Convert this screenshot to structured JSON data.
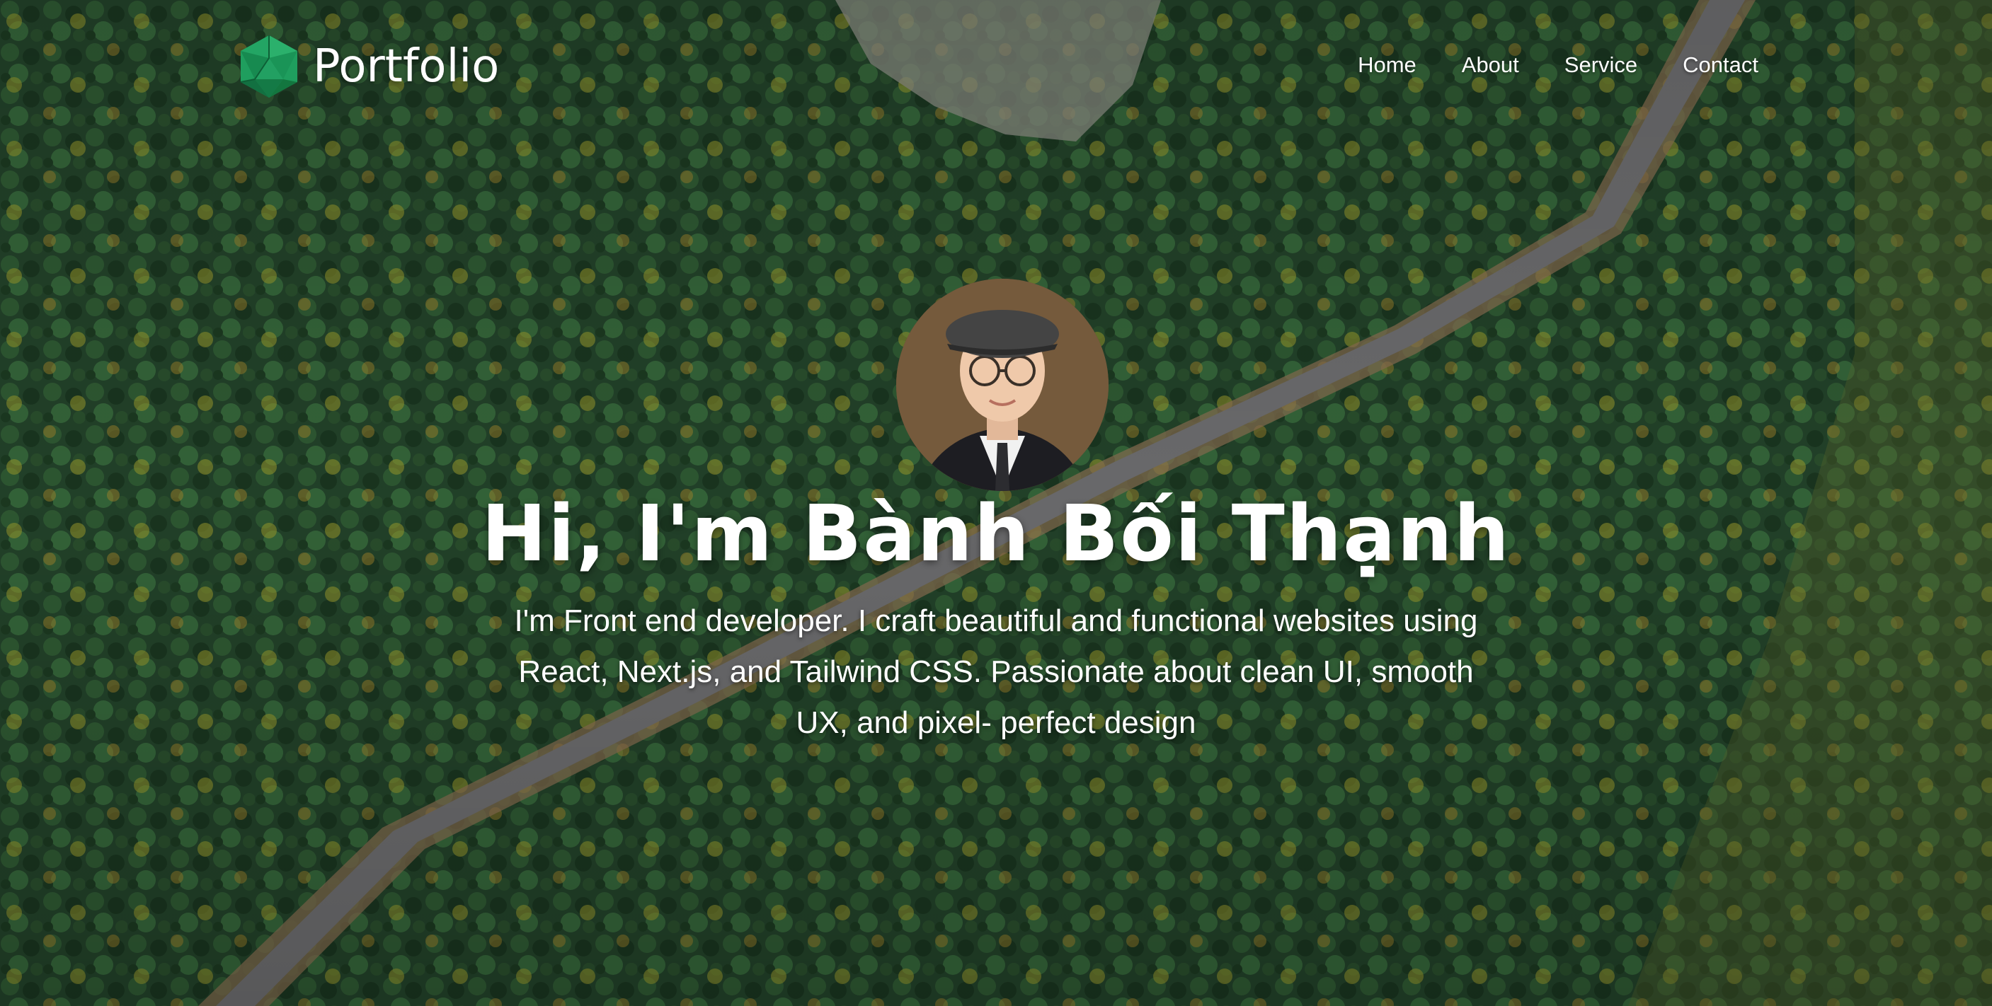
{
  "header": {
    "logo_text": "Portfolio",
    "logo_icon": "icosahedron-icon",
    "nav": [
      {
        "label": "Home"
      },
      {
        "label": "About"
      },
      {
        "label": "Service"
      },
      {
        "label": "Contact"
      }
    ]
  },
  "hero": {
    "title": "Hi, I'm Bành Bối Thạnh",
    "description": "I'm Front end developer. I craft beautiful and functional websites using React, Next.js, and Tailwind CSS. Passionate about clean UI, smooth UX, and pixel- perfect design",
    "avatar": "profile-photo"
  },
  "colors": {
    "logo_green": "#1f9e5e",
    "text": "#ffffff",
    "forest_dark": "#1d3b1f",
    "road": "#6e6e70"
  }
}
